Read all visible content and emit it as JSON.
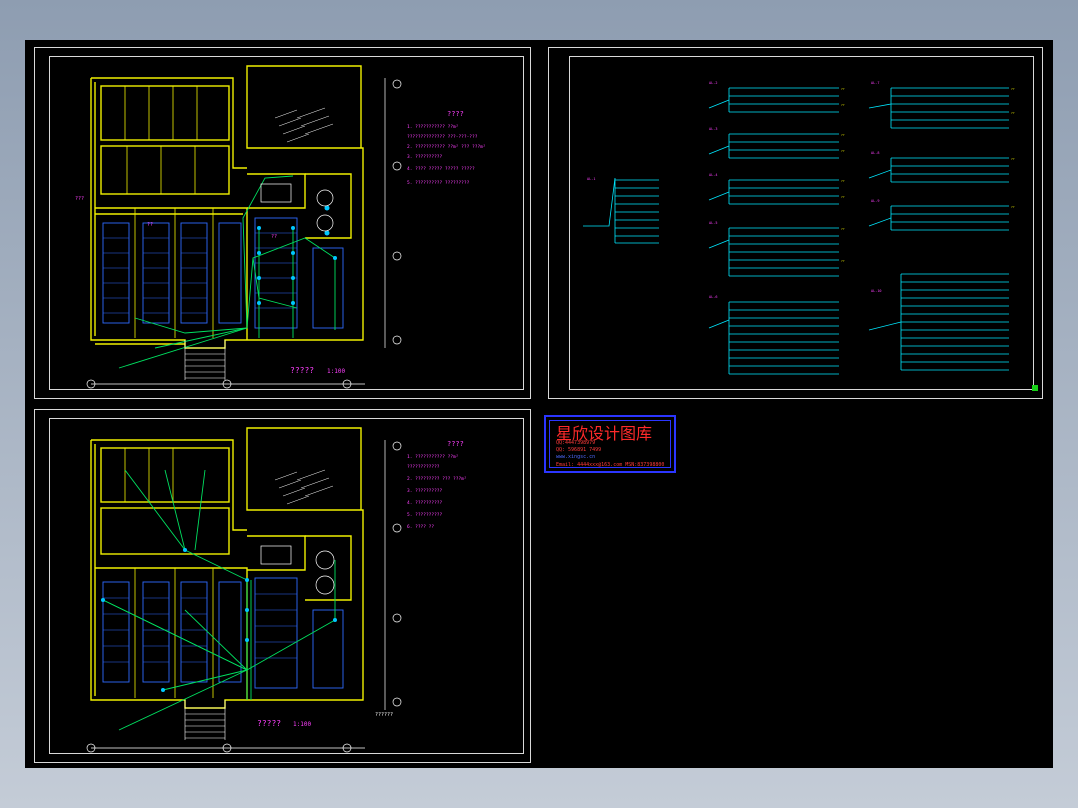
{
  "plans": {
    "top": {
      "title": "?????",
      "scale": "1:100",
      "notes_heading": "????",
      "notes": [
        "1. ???????????  ??m²",
        "   ??????????????   ???-???-???",
        "2. ???????????  ??m²   ???   ???m²",
        "3. ??????????",
        "4. ????  ?????  ?????  ?????",
        "5. ??????????   ?????????"
      ],
      "axis_marks": [
        "A",
        "B",
        "C",
        "D"
      ]
    },
    "bottom": {
      "title": "?????",
      "scale": "1:100",
      "extra_label": "??????",
      "notes_heading": "????",
      "notes": [
        "1. ???????????  ??m²",
        "   ????????????",
        "2. ?????????   ???  ???m²",
        "3. ??????????",
        "4. ??????????",
        "5. ??????????",
        "6. ????   ??"
      ],
      "axis_marks": [
        "A",
        "B",
        "C",
        "D"
      ]
    }
  },
  "logo": {
    "title": "星欣设计图库",
    "line1": "QQ:4447398979",
    "line2": "QQ: 596891 7499",
    "url": "www.xingsc.cn",
    "email": "Email: 4444xxx@163.com  MSN:837398800"
  },
  "colors": {
    "background": "#000000",
    "frame": "#d8d8d8",
    "wall": "#f0f000",
    "wiring": "#00e060",
    "fixture": "#00c8ff",
    "label": "#ff40ff",
    "logo_border": "#2b35ff",
    "logo_text": "#ff2a2a"
  }
}
